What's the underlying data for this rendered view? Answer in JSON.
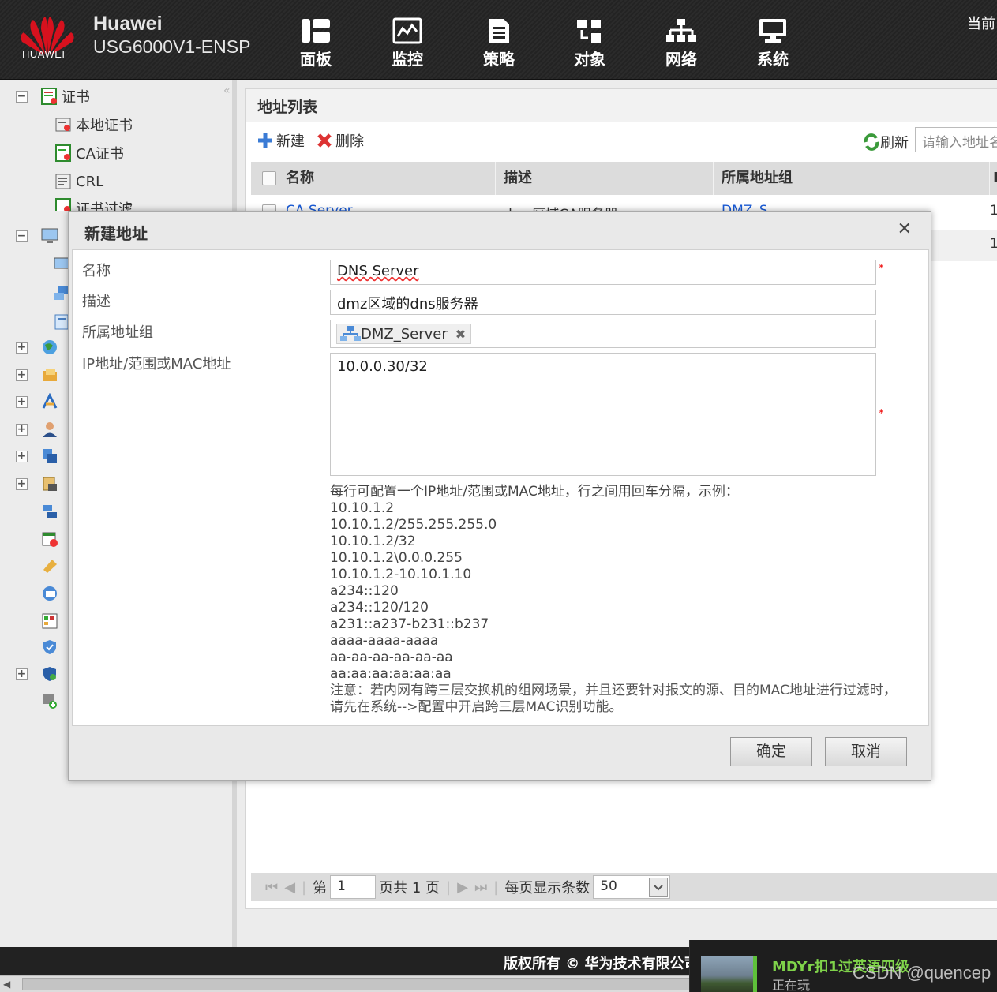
{
  "header": {
    "logo_text": "HUAWEI",
    "brand": "Huawei",
    "model": "USG6000V1-ENSP",
    "current_user_label": "当前",
    "nav": [
      {
        "label": "面板",
        "icon": "dashboard-icon"
      },
      {
        "label": "监控",
        "icon": "monitor-icon"
      },
      {
        "label": "策略",
        "icon": "policy-icon"
      },
      {
        "label": "对象",
        "icon": "object-icon"
      },
      {
        "label": "网络",
        "icon": "network-icon"
      },
      {
        "label": "系统",
        "icon": "system-icon"
      }
    ]
  },
  "sidebar": {
    "collapse_symbol": "«",
    "cert_group": "证书",
    "items": {
      "local_cert": "本地证书",
      "ca_cert": "CA证书",
      "crl": "CRL",
      "cert_filter": "证书过滤"
    }
  },
  "main": {
    "title": "地址列表",
    "toolbar": {
      "new": "新建",
      "delete": "删除",
      "refresh": "刷新"
    },
    "search_placeholder": "请输入地址名",
    "columns": [
      "名称",
      "描述",
      "所属地址组",
      "I"
    ],
    "rows": [
      {
        "name": "CA Server",
        "desc": "dmz区域CA服务器",
        "group": "DMZ_S",
        "ref": "1"
      },
      {
        "name": "",
        "desc": "",
        "group": "",
        "ref": "1"
      }
    ],
    "pager": {
      "page_prefix": "第",
      "page_value": "1",
      "page_suffix": "页共 1 页",
      "per_page_label": "每页显示条数",
      "per_page_value": "50"
    }
  },
  "dialog": {
    "title": "新建地址",
    "close_symbol": "✕",
    "fields": {
      "name_label": "名称",
      "name_value": "DNS Server",
      "desc_label": "描述",
      "desc_value": "dmz区域的dns服务器",
      "group_label": "所属地址组",
      "group_tag": "DMZ_Server",
      "ip_label": "IP地址/范围或MAC地址",
      "ip_value": "10.0.0.30/32",
      "required_mark": "*"
    },
    "help_intro": "每行可配置一个IP地址/范围或MAC地址，行之间用回车分隔，示例：",
    "help_examples": [
      "10.10.1.2",
      "10.10.1.2/255.255.255.0",
      "10.10.1.2/32",
      "10.10.1.2\\0.0.0.255",
      "10.10.1.2-10.10.1.10",
      "a234::120",
      "a234::120/120",
      "a231::a237-b231::b237",
      "aaaa-aaaa-aaaa",
      "aa-aa-aa-aa-aa-aa",
      "aa:aa:aa:aa:aa:aa"
    ],
    "help_note": "注意：若内网有跨三层交换机的组网场景，并且还要针对报文的源、目的MAC地址进行过滤时，请先在系统-->配置中开启跨三层MAC识别功能。",
    "ok": "确定",
    "cancel": "取消"
  },
  "footer": {
    "copyright": "版权所有 © 华为技术有限公司"
  },
  "notification": {
    "title": "MDYr扣1过英语四级",
    "status": "正在玩"
  },
  "watermark": "CSDN @quencep",
  "colors": {
    "brand_red": "#d7111e",
    "link_blue": "#1a5bd6",
    "nav_bg": "#262626",
    "accent_green": "#5ec13a"
  }
}
